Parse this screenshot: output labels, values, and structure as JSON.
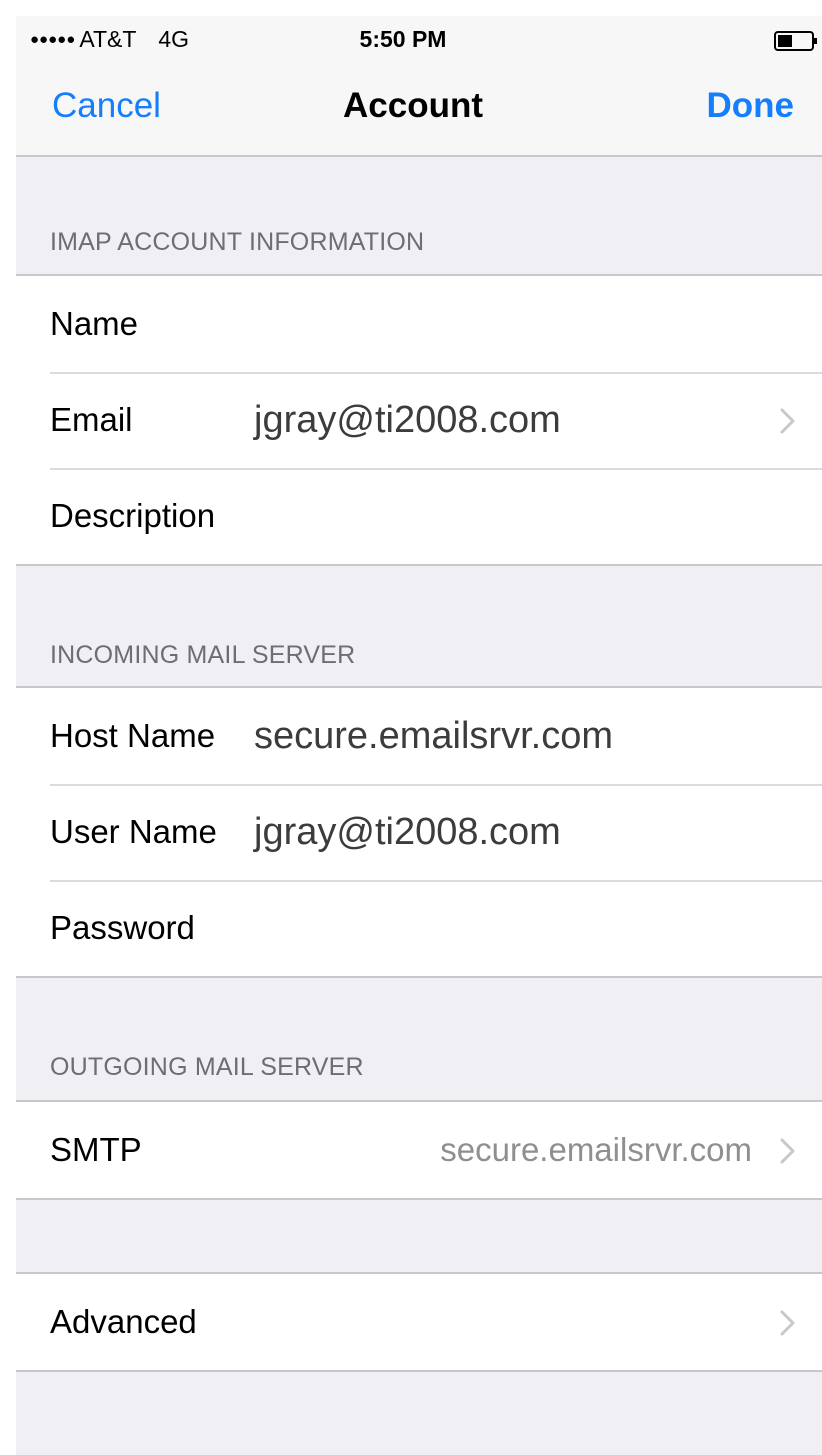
{
  "status_bar": {
    "signal": "●●●●●",
    "carrier": "AT&T",
    "network": "4G",
    "time": "5:50 PM"
  },
  "nav": {
    "cancel_label": "Cancel",
    "title": "Account",
    "done_label": "Done"
  },
  "sections": {
    "imap_header": "IMAP ACCOUNT INFORMATION",
    "incoming_header": "INCOMING MAIL SERVER",
    "outgoing_header": "OUTGOING MAIL SERVER"
  },
  "imap": {
    "name_label": "Name",
    "name_value": "",
    "email_label": "Email",
    "email_value": "jgray@ti2008.com",
    "description_label": "Description",
    "description_value": ""
  },
  "incoming": {
    "host_label": "Host Name",
    "host_value": "secure.emailsrvr.com",
    "user_label": "User Name",
    "user_value": "jgray@ti2008.com",
    "password_label": "Password",
    "password_value": ""
  },
  "outgoing": {
    "smtp_label": "SMTP",
    "smtp_value": "secure.emailsrvr.com"
  },
  "advanced": {
    "label": "Advanced"
  },
  "colors": {
    "accent": "#157efb",
    "background": "#efeff4",
    "separator": "#c8c7cc"
  }
}
